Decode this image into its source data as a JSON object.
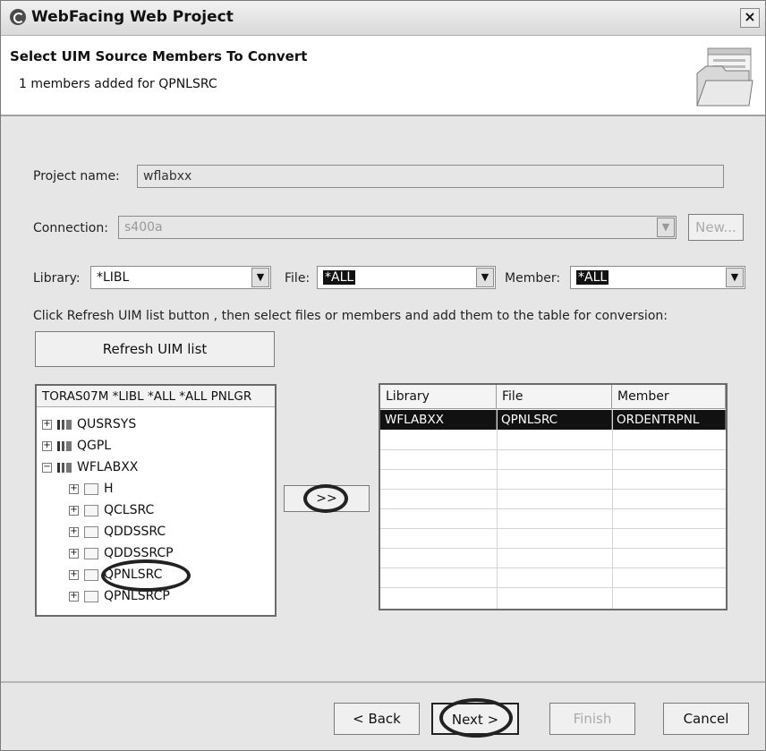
{
  "window": {
    "title": "WebFacing Web Project",
    "close_label": "×"
  },
  "banner": {
    "title": "Select UIM Source Members To Convert",
    "subtitle": "1 members added for QPNLSRC"
  },
  "form": {
    "project_label": "Project name:",
    "project_value": "wflabxx",
    "connection_label": "Connection:",
    "connection_value": "s400a",
    "new_button": "New...",
    "library_label": "Library:",
    "library_value": "*LIBL",
    "file_label": "File:",
    "file_value": "*ALL",
    "member_label": "Member:",
    "member_value": "*ALL",
    "instructions": "Click Refresh UIM list button , then select files or members and add them to the table for conversion:",
    "refresh_button": "Refresh UIM list"
  },
  "tree": {
    "header": "TORAS07M *LIBL *ALL *ALL PNLGR",
    "nodes": [
      "QUSRSYS",
      "QGPL",
      "WFLABXX",
      "H",
      "QCLSRC",
      "QDDSSRC",
      "QDDSSRCP",
      "QPNLSRC",
      "QPNLSRCP"
    ]
  },
  "add_button": ">>",
  "table": {
    "headers": [
      "Library",
      "File",
      "Member"
    ],
    "rows": [
      [
        "WFLABXX",
        "QPNLSRC",
        "ORDENTRPNL"
      ]
    ]
  },
  "footer": {
    "back": "< Back",
    "next": "Next >",
    "finish": "Finish",
    "cancel": "Cancel"
  }
}
